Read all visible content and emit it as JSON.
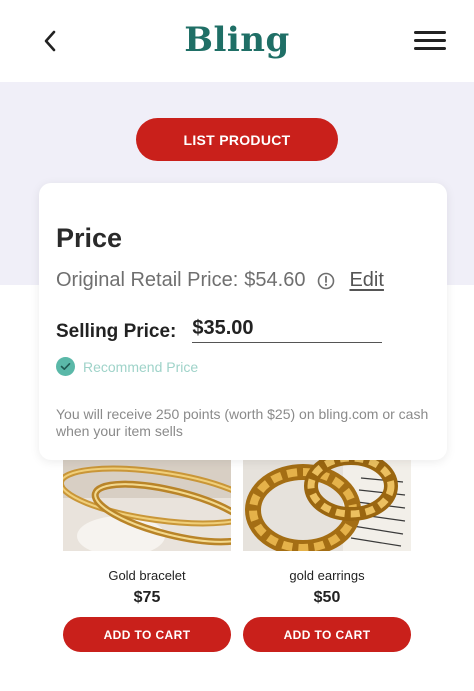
{
  "header": {
    "logo": "Bling",
    "back_icon": "chevron-left-icon",
    "menu_icon": "hamburger-menu-icon"
  },
  "actions": {
    "list_product_label": "LIST PRODUCT"
  },
  "price_card": {
    "title": "Price",
    "original_label": "Original Retail Price:",
    "original_value": "$54.60",
    "info_icon": "info-icon",
    "edit_label": "Edit",
    "selling_label": "Selling Price:",
    "selling_value": "$35.00",
    "recommend_label": "Recommend Price",
    "recommend_checked": true,
    "note": "You will receive 250 points (worth $25) on bling.com or cash when your item sells"
  },
  "products": [
    {
      "name": "Gold bracelet",
      "price": "$75",
      "cart_label": "ADD TO CART"
    },
    {
      "name": "gold earrings",
      "price": "$50",
      "cart_label": "ADD TO CART"
    }
  ],
  "colors": {
    "brand": "#1f6f66",
    "accent": "#c9201b",
    "band": "#f0eff8",
    "check": "#5ab8a8"
  }
}
